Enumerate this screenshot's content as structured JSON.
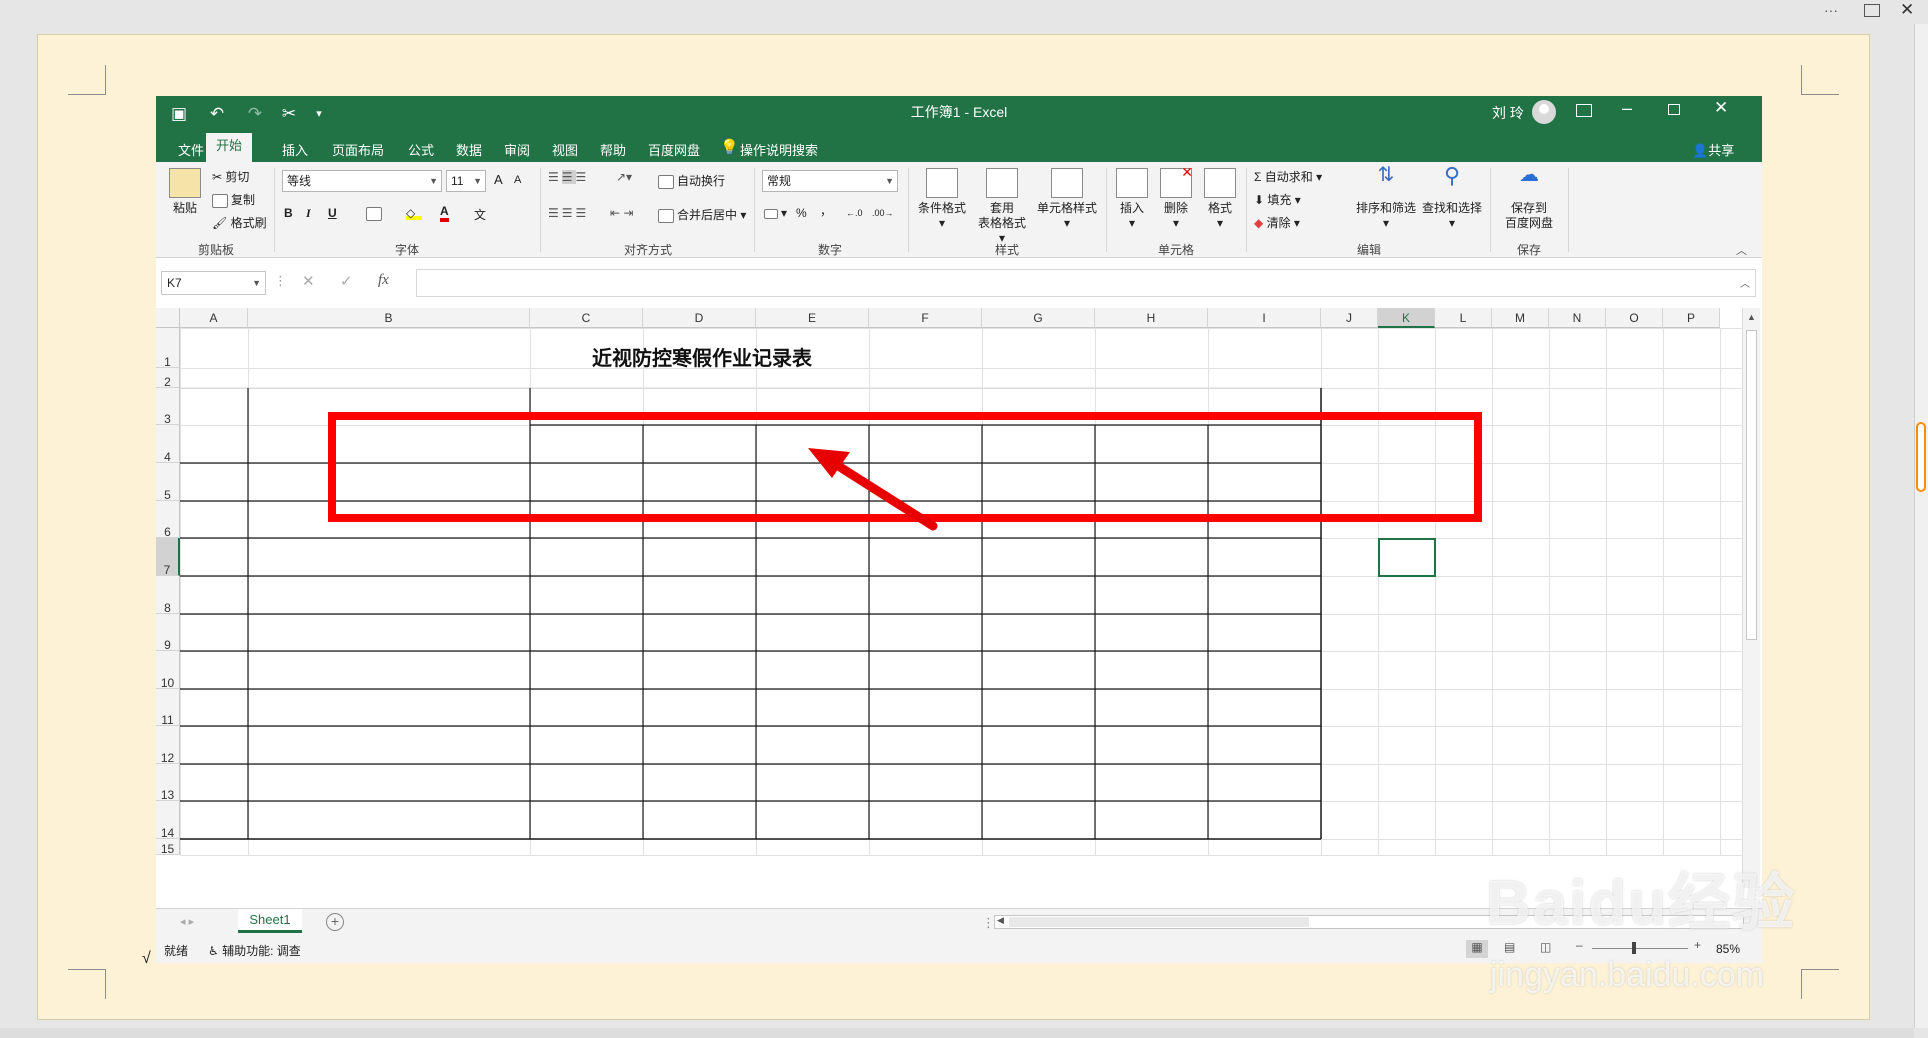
{
  "window": {
    "title": "工作簿1 - Excel",
    "user": "刘 玲"
  },
  "outer": {
    "more": "···"
  },
  "tabs": [
    {
      "label": "文件"
    },
    {
      "label": "开始"
    },
    {
      "label": "插入"
    },
    {
      "label": "页面布局"
    },
    {
      "label": "公式"
    },
    {
      "label": "数据"
    },
    {
      "label": "审阅"
    },
    {
      "label": "视图"
    },
    {
      "label": "帮助"
    },
    {
      "label": "百度网盘"
    }
  ],
  "tell_me": "操作说明搜索",
  "share": "共享",
  "ribbon": {
    "clipboard": {
      "paste": "粘贴",
      "cut": "剪切",
      "copy": "复制",
      "format_painter": "格式刷",
      "label": "剪贴板"
    },
    "font": {
      "name": "等线",
      "size": "11",
      "bold": "B",
      "italic": "I",
      "underline": "U",
      "grow": "A",
      "shrink": "A",
      "font_color": "A",
      "wen": "文",
      "label": "字体"
    },
    "align": {
      "wrap": "自动换行",
      "merge": "合并后居中",
      "label": "对齐方式"
    },
    "number": {
      "format": "常规",
      "percent": "%",
      "comma": "，",
      "label": "数字"
    },
    "styles": {
      "cond": "条件格式",
      "table_1": "套用",
      "table_2": "表格格式",
      "cell": "单元格样式",
      "label": "样式"
    },
    "cells": {
      "insert": "插入",
      "delete": "删除",
      "format": "格式",
      "label": "单元格"
    },
    "editing": {
      "autosum": "自动求和",
      "fill": "填充",
      "clear": "清除",
      "sort": "排序和筛选",
      "find": "查找和选择",
      "label": "编辑"
    },
    "save": {
      "line1": "保存到",
      "line2": "百度网盘",
      "label": "保存"
    }
  },
  "formula": {
    "name_box": "K7",
    "fx": "fx",
    "value": ""
  },
  "columns": [
    "A",
    "B",
    "C",
    "D",
    "E",
    "F",
    "G",
    "H",
    "I",
    "J",
    "K",
    "L",
    "M",
    "N",
    "O",
    "P"
  ],
  "rows": [
    "1",
    "2",
    "3",
    "4",
    "5",
    "6",
    "7",
    "8",
    "9",
    "10",
    "11",
    "12",
    "13",
    "14",
    "15"
  ],
  "sheet": {
    "title": "近视防控寒假作业记录表",
    "active_cell": "K7",
    "tab": "Sheet1"
  },
  "status": {
    "ready": "就绪",
    "accessibility": "辅助功能: 调查",
    "zoom": "85%"
  },
  "watermark": {
    "line1": "Baidu经验",
    "line2": "jingyan.baidu.com"
  },
  "misc": {
    "check": "√"
  },
  "colors": {
    "excel_green": "#217346",
    "highlight": "#ff0000"
  }
}
